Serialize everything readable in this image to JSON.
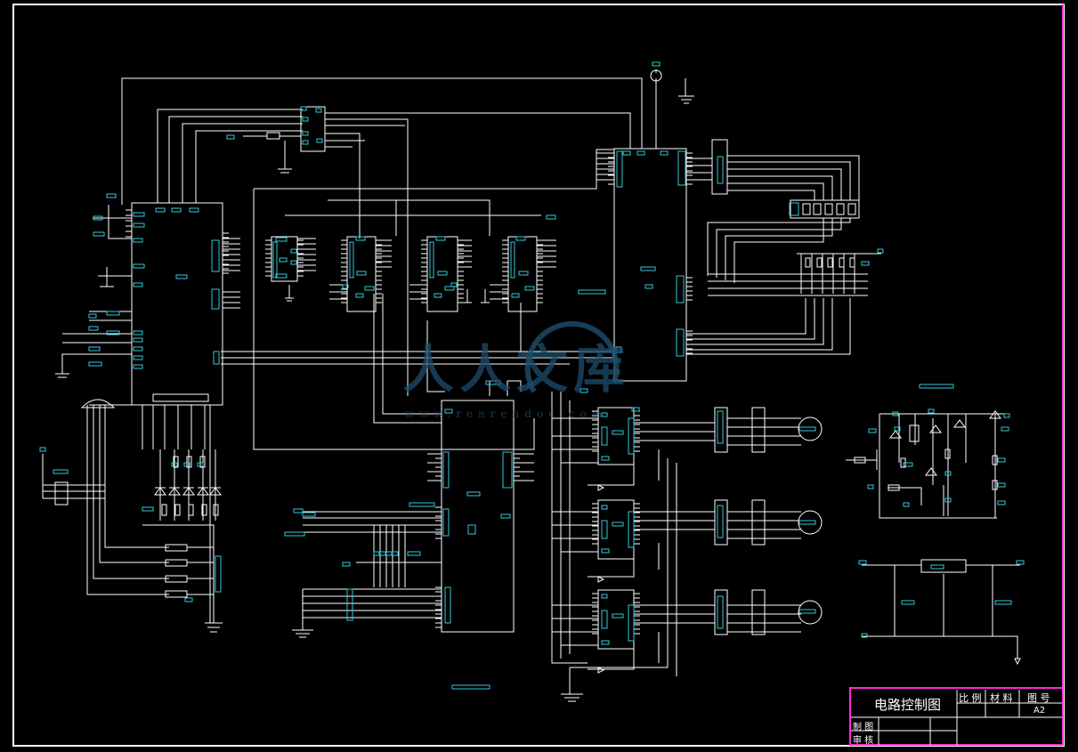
{
  "title_block": {
    "drawing_title": "电路控制图",
    "header_scale": "比 例",
    "header_material": "材 料",
    "header_drawing_no": "图 号",
    "sheet_size": "A2",
    "row_drawn": "制 图",
    "row_checked": "审 核"
  },
  "watermark": {
    "logo_text": "人人文库",
    "url_text": "www.renrendoc.com"
  },
  "colors": {
    "background": "#000000",
    "line": "#ffffff",
    "component_tag": "#35c7d8",
    "frame_border": "#ff2bd6",
    "watermark": "#1e4d6e"
  }
}
